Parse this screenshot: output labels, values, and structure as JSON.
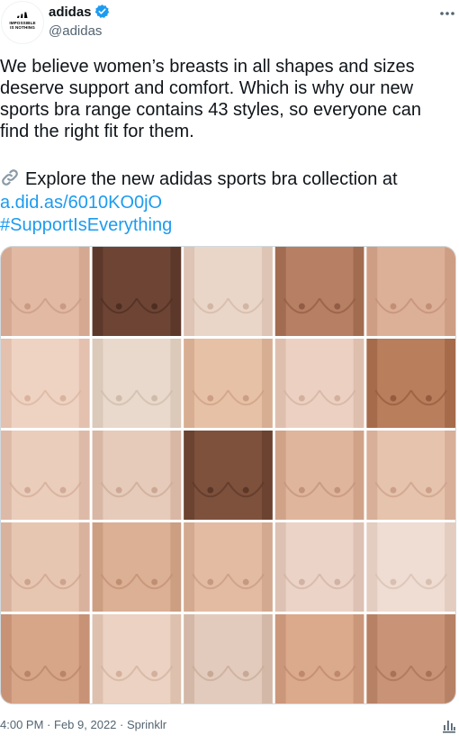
{
  "account": {
    "display_name": "adidas",
    "handle": "@adidas",
    "avatar_logo_text_line1": "IMPOSSIBLE",
    "avatar_logo_text_line2": "IS NOTHING",
    "verified_color": "#1d9bf0"
  },
  "tweet": {
    "body": "We believe women’s breasts in all shapes and sizes\ndeserve support and comfort. Which is why our new\nsports bra range contains 43 styles, so everyone can\nfind the right fit for them.",
    "explore_emoji_icon": "link-icon",
    "explore_text": "Explore the new adidas sports bra collection at",
    "url": "a.did.as/6010KO0jO",
    "hashtag": "#SupportIsEverything"
  },
  "media": {
    "rows": 5,
    "cols": 5,
    "tiles": [
      {
        "base": "#e2b9a3",
        "shade": "#c99a84"
      },
      {
        "base": "#6e4535",
        "shade": "#4f2e22"
      },
      {
        "base": "#ead6c8",
        "shade": "#d2b6a4"
      },
      {
        "base": "#b77f63",
        "shade": "#925c44"
      },
      {
        "base": "#dcb097",
        "shade": "#c28f75"
      },
      {
        "base": "#efd3c2",
        "shade": "#d9b39f"
      },
      {
        "base": "#e8d9cc",
        "shade": "#cfbba9"
      },
      {
        "base": "#e7c1a6",
        "shade": "#cc9e83"
      },
      {
        "base": "#ecd1c3",
        "shade": "#d3b09d"
      },
      {
        "base": "#b97e5c",
        "shade": "#955b3c"
      },
      {
        "base": "#eacdbb",
        "shade": "#d1ab97"
      },
      {
        "base": "#e6cbbb",
        "shade": "#cca894"
      },
      {
        "base": "#7e513d",
        "shade": "#5c3727"
      },
      {
        "base": "#dfb59c",
        "shade": "#c2937a"
      },
      {
        "base": "#e6c3ad",
        "shade": "#cc9f88"
      },
      {
        "base": "#e7c6b1",
        "shade": "#cda38d"
      },
      {
        "base": "#dcb094",
        "shade": "#c08f73"
      },
      {
        "base": "#e3bba3",
        "shade": "#c69a80"
      },
      {
        "base": "#ebd3c7",
        "shade": "#d1b2a3"
      },
      {
        "base": "#efdcd2",
        "shade": "#d8bfb1"
      },
      {
        "base": "#d7a588",
        "shade": "#b98467"
      },
      {
        "base": "#ecd2c2",
        "shade": "#d2b09c"
      },
      {
        "base": "#e2cbbd",
        "shade": "#c7a996"
      },
      {
        "base": "#dba98c",
        "shade": "#bd886c"
      },
      {
        "base": "#c99377",
        "shade": "#a87257"
      }
    ]
  },
  "meta": {
    "time": "4:00 PM",
    "separator": "·",
    "date": "Feb 9, 2022",
    "source": "Sprinklr",
    "analytics_icon": "analytics-icon"
  },
  "colors": {
    "text": "#0f1419",
    "secondary": "#536471",
    "link": "#1d9bf0",
    "border": "#cfd9de"
  }
}
